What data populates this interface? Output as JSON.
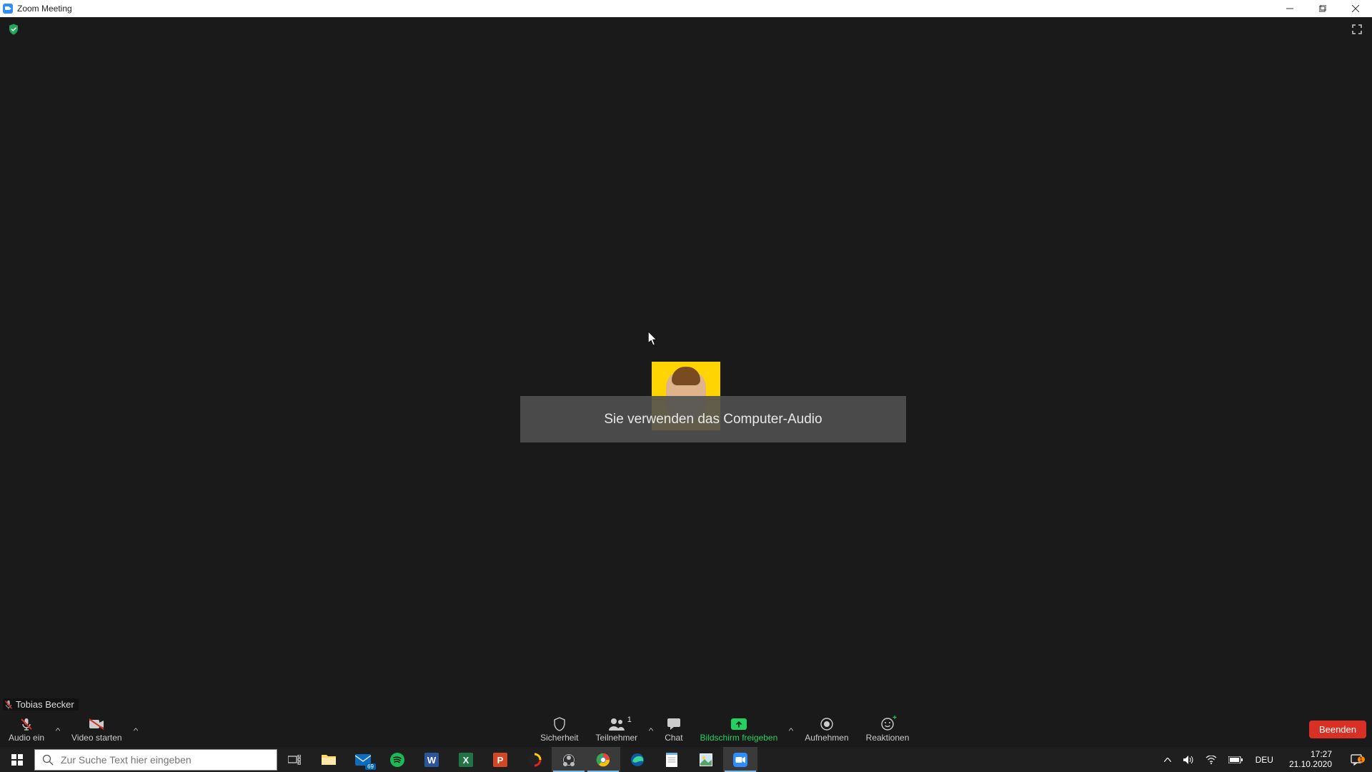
{
  "window": {
    "title": "Zoom Meeting"
  },
  "toast": {
    "message": "Sie verwenden das Computer-Audio"
  },
  "self": {
    "name": "Tobias Becker"
  },
  "controls": {
    "audio": "Audio ein",
    "video": "Video starten",
    "security": "Sicherheit",
    "participants": "Teilnehmer",
    "participants_count": "1",
    "chat": "Chat",
    "share": "Bildschirm freigeben",
    "record": "Aufnehmen",
    "reactions": "Reaktionen",
    "end": "Beenden"
  },
  "taskbar": {
    "search_placeholder": "Zur Suche Text hier eingeben",
    "mail_badge": "69",
    "lang": "DEU",
    "time": "17:27",
    "date": "21.10.2020",
    "notif_count": "1"
  }
}
